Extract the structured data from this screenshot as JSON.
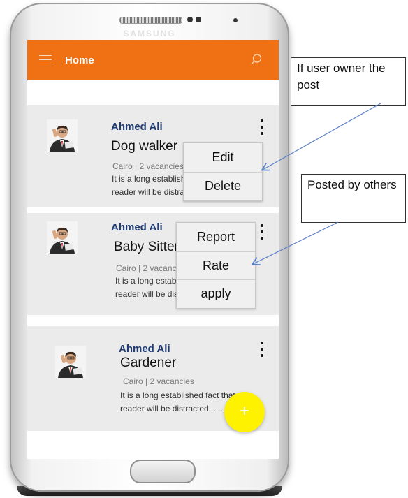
{
  "device": {
    "brand": "SAMSUNG"
  },
  "appbar": {
    "title": "Home",
    "menu_icon": "hamburger-icon",
    "search_icon": "search-icon",
    "color": "#f07113"
  },
  "posts": [
    {
      "author": "Ahmed Ali",
      "title": "Dog walker",
      "meta": "Cairo | 2 vacancies",
      "description_line1": "It is a long established fact that a",
      "description_line2": "reader will be distracted ....."
    },
    {
      "author": "Ahmed Ali",
      "title": "Baby Sitter",
      "meta": "Cairo | 2 vacancies",
      "description_line1": "It is a long established fact that a",
      "description_line2": "reader will be distracted ....."
    },
    {
      "author": "Ahmed Ali",
      "title": "Gardener",
      "meta": "Cairo | 2 vacancies",
      "description_line1": "It is a long established fact that a",
      "description_line2": "reader will be distracted ....."
    }
  ],
  "owner_menu": {
    "items": [
      "Edit",
      "Delete"
    ]
  },
  "others_menu": {
    "items": [
      "Report",
      "Rate",
      "apply"
    ]
  },
  "fab": {
    "label": "+",
    "color": "#fff200"
  },
  "annotations": {
    "owner_note": "If user owner the post",
    "others_note": "Posted by others"
  }
}
